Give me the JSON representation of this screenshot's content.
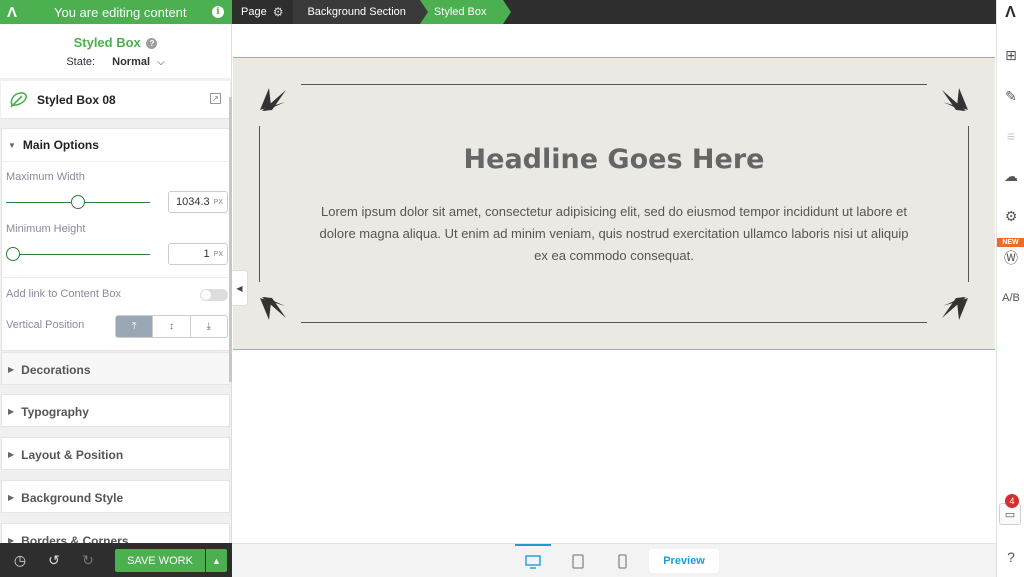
{
  "topbar": {
    "banner_text": "You are editing content",
    "crumbs": [
      "Page",
      "Background Section",
      "Styled Box"
    ]
  },
  "panel": {
    "title": "Styled Box",
    "state_label": "State:",
    "state_value": "Normal",
    "preset_name": "Styled Box 08",
    "sections": {
      "main_options": "Main Options",
      "decorations": "Decorations",
      "typography": "Typography",
      "layout_position": "Layout & Position",
      "background_style": "Background Style",
      "borders_corners": "Borders & Corners"
    },
    "fields": {
      "max_width_label": "Maximum Width",
      "max_width_value": "1034.3",
      "max_width_unit": "PX",
      "max_width_slider_fraction": 0.5,
      "min_height_label": "Minimum Height",
      "min_height_value": "1",
      "min_height_unit": "PX",
      "min_height_slider_fraction": 0.0,
      "link_label": "Add link to Content Box",
      "link_enabled": false,
      "vpos_label": "Vertical Position",
      "vpos_selected": "top"
    }
  },
  "bottom": {
    "save_label": "SAVE WORK",
    "preview_label": "Preview",
    "active_device": "desktop"
  },
  "canvas": {
    "headline": "Headline Goes Here",
    "body": "Lorem ipsum dolor sit amet, consectetur adipisicing elit, sed do eiusmod tempor incididunt ut labore et dolore magna aliqua. Ut enim ad minim veniam, quis nostrud exercitation ullamco laboris nisi ut aliquip ex ea commodo consequat."
  },
  "rightbar": {
    "new_badge": "NEW",
    "notification_count": "4",
    "ab_label": "A/B"
  },
  "colors": {
    "accent_green": "#4caf50",
    "dark_bar": "#2e2e2e",
    "box_bg": "#ebe9e4",
    "device_active": "#1e9bd7"
  }
}
